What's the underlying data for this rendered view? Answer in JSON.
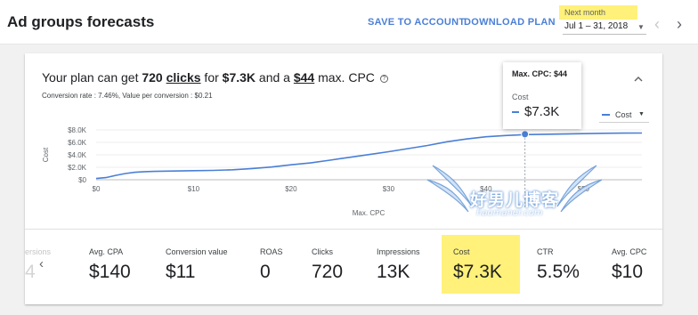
{
  "header": {
    "title": "Ad groups forecasts",
    "save_label": "SAVE TO ACCOUNT",
    "download_label": "DOWNLOAD PLAN",
    "range_label": "Next month",
    "range_value": "Jul 1 – 31, 2018",
    "prev_icon": "chevron-left-icon",
    "next_icon": "chevron-right-icon"
  },
  "summary": {
    "prefix": "Your plan can get ",
    "clicks_value": "720",
    "clicks_word": "clicks",
    "mid": " for ",
    "cost_value": "$7.3K",
    "and_a": " and a ",
    "max_cpc_value": "$44",
    "suffix": " max. CPC",
    "help_icon": "?",
    "subline": "Conversion rate : 7.46%, Value per conversion : $0.21",
    "collapse_icon": "chevron-up-icon"
  },
  "chart_data": {
    "type": "line",
    "xlabel": "Max. CPC",
    "ylabel": "Cost",
    "x_ticks": [
      "$0",
      "$10",
      "$20",
      "$30",
      "$40",
      "$50"
    ],
    "y_ticks": [
      "$0",
      "$2.0K",
      "$4.0K",
      "$6.0K",
      "$8.0K"
    ],
    "xlim": [
      0,
      56
    ],
    "ylim": [
      0,
      8000
    ],
    "series": [
      {
        "name": "Cost",
        "color": "#4a7fd6",
        "x": [
          0,
          1,
          2,
          3,
          4,
          5,
          6,
          8,
          10,
          12,
          14,
          16,
          18,
          20,
          22,
          24,
          26,
          28,
          30,
          32,
          34,
          36,
          38,
          40,
          42,
          44,
          46,
          48,
          50,
          52,
          54,
          56
        ],
        "y": [
          200,
          350,
          700,
          1000,
          1200,
          1300,
          1350,
          1400,
          1450,
          1500,
          1600,
          1800,
          2050,
          2400,
          2700,
          3150,
          3600,
          4050,
          4500,
          5000,
          5500,
          6100,
          6550,
          6900,
          7100,
          7250,
          7300,
          7350,
          7400,
          7450,
          7480,
          7500
        ]
      }
    ],
    "highlight": {
      "x": 44,
      "y": 7300
    },
    "legend_label": "Cost",
    "grid": true
  },
  "tooltip": {
    "title": "Max. CPC: $44",
    "label": "Cost",
    "value": "$7.3K"
  },
  "metrics": {
    "ghost_label": "ersions",
    "ghost_value": "4",
    "items": [
      {
        "label": "Avg. CPA",
        "value": "$140"
      },
      {
        "label": "Conversion value",
        "value": "$11"
      },
      {
        "label": "ROAS",
        "value": "0"
      },
      {
        "label": "Clicks",
        "value": "720"
      },
      {
        "label": "Impressions",
        "value": "13K"
      },
      {
        "label": "Cost",
        "value": "$7.3K"
      },
      {
        "label": "CTR",
        "value": "5.5%"
      },
      {
        "label": "Avg. CPC",
        "value": "$10"
      }
    ]
  },
  "watermark": {
    "main": "好男儿博客",
    "sub": "haomaner.com"
  },
  "colors": {
    "accent": "#4a7fd6",
    "highlight": "#fff17a"
  }
}
